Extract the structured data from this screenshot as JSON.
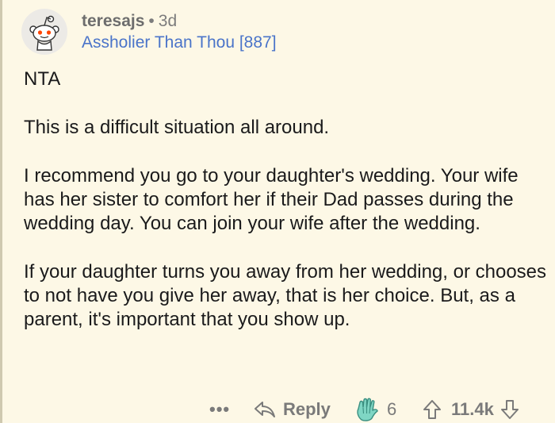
{
  "comment": {
    "username": "teresajs",
    "separator": "•",
    "age": "3d",
    "flair": "Assholier Than Thou [887]",
    "paragraphs": [
      "NTA",
      "This is a difficult situation all around.",
      "I recommend you go to your daughter's wedding. Your wife has her sister to comfort her if their Dad passes during the wedding day.  You can join your wife after the wedding.",
      "If your daughter turns you away from her wedding, or chooses to not have you give her away, that is her choice.  But, as a parent, it's important that you show up."
    ]
  },
  "actions": {
    "more": "•••",
    "reply_label": "Reply",
    "award_count": "6",
    "score": "11.4k"
  },
  "colors": {
    "background": "#fdf8e6",
    "flair": "#4a74c9",
    "meta": "#7c7c7c",
    "award_icon": "#5bb7a6"
  },
  "icons": {
    "avatar": "snoo-avatar-icon",
    "reply": "reply-arrow-icon",
    "award": "clapping-hand-award-icon",
    "upvote": "upvote-arrow-icon",
    "downvote": "downvote-arrow-icon"
  }
}
